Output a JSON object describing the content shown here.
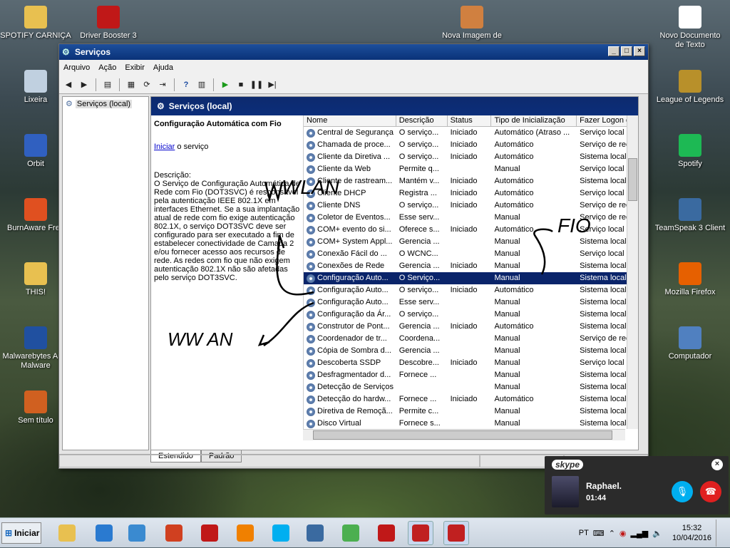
{
  "desktop_icons": [
    {
      "label": "SPOTIFY CARNIÇA",
      "icon": "folder-icon",
      "color": "#e8c050"
    },
    {
      "label": "Driver Booster 3",
      "icon": "driver-booster-icon",
      "color": "#c01818"
    },
    {
      "label": "Nova Imagem de",
      "icon": "image-file-icon",
      "color": "#d08040"
    },
    {
      "label": "Novo Documento de Texto",
      "icon": "text-document-icon",
      "color": "#ffffff"
    },
    {
      "label": "Lixeira",
      "icon": "recycle-bin-icon",
      "color": "#c0d0e0"
    },
    {
      "label": "League of Legends",
      "icon": "league-icon",
      "color": "#b8902a"
    },
    {
      "label": "Orbit",
      "icon": "orbit-icon",
      "color": "#3060c0"
    },
    {
      "label": "Spotify",
      "icon": "spotify-icon",
      "color": "#1db954"
    },
    {
      "label": "BurnAware Free",
      "icon": "burnaware-icon",
      "color": "#e05020"
    },
    {
      "label": "TeamSpeak 3 Client",
      "icon": "teamspeak-icon",
      "color": "#3a6aa0"
    },
    {
      "label": "THIS!",
      "icon": "folder-icon",
      "color": "#e8c050"
    },
    {
      "label": "Mozilla Firefox",
      "icon": "firefox-icon",
      "color": "#e66000"
    },
    {
      "label": "Malwarebytes Anti-Malware",
      "icon": "malwarebytes-icon",
      "color": "#2050a0"
    },
    {
      "label": "Computador",
      "icon": "computer-icon",
      "color": "#5080c0"
    },
    {
      "label": "Sem título",
      "icon": "paint-icon",
      "color": "#d06020"
    }
  ],
  "window": {
    "title": "Serviços",
    "menu": [
      "Arquivo",
      "Ação",
      "Exibir",
      "Ajuda"
    ],
    "tree_item": "Serviços (local)",
    "pane_header": "Serviços (local)",
    "selected_title": "Configuração Automática com Fio",
    "start_link": "Iniciar",
    "start_suffix": " o serviço",
    "desc_label": "Descrição:",
    "desc_text": "O Serviço de Configuração Automática de Rede com Fio (DOT3SVC) é responsável pela autenticação IEEE 802.1X em interfaces Ethernet. Se a sua implantação atual de rede com fio exige autenticação 802.1X, o serviço DOT3SVC deve ser configurado para ser executado a fim de estabelecer conectividade de Camada 2 e/ou fornecer acesso aos recursos de rede. As redes com fio que não exigem autenticação 802.1X não são afetadas pelo serviço DOT3SVC.",
    "columns": [
      "Nome",
      "Descrição",
      "Status",
      "Tipo de Inicialização",
      "Fazer Logon c"
    ],
    "rows": [
      [
        "Central de Segurança",
        "O serviço...",
        "Iniciado",
        "Automático (Atraso ...",
        "Serviço local"
      ],
      [
        "Chamada de proce...",
        "O serviço...",
        "Iniciado",
        "Automático",
        "Serviço de rec"
      ],
      [
        "Cliente da Diretiva ...",
        "O serviço...",
        "Iniciado",
        "Automático",
        "Sistema local"
      ],
      [
        "Cliente da Web",
        "Permite q...",
        "",
        "Manual",
        "Serviço local"
      ],
      [
        "Cliente de rastream...",
        "Mantém v...",
        "Iniciado",
        "Automático",
        "Sistema local"
      ],
      [
        "Cliente DHCP",
        "Registra ...",
        "Iniciado",
        "Automático",
        "Serviço local"
      ],
      [
        "Cliente DNS",
        "O serviço...",
        "Iniciado",
        "Automático",
        "Serviço de rec"
      ],
      [
        "Coletor de Eventos...",
        "Esse serv...",
        "",
        "Manual",
        "Serviço de rec"
      ],
      [
        "COM+ evento do si...",
        "Oferece s...",
        "Iniciado",
        "Automático",
        "Serviço local"
      ],
      [
        "COM+ System Appl...",
        "Gerencia ...",
        "",
        "Manual",
        "Sistema local"
      ],
      [
        "Conexão Fácil do ...",
        "O WCNC...",
        "",
        "Manual",
        "Serviço local"
      ],
      [
        "Conexões de Rede",
        "Gerencia ...",
        "Iniciado",
        "Manual",
        "Sistema local"
      ],
      [
        "Configuração Auto...",
        "O Serviço...",
        "",
        "Manual",
        "Sistema local"
      ],
      [
        "Configuração Auto...",
        "O serviço...",
        "Iniciado",
        "Automático",
        "Sistema local"
      ],
      [
        "Configuração Auto...",
        "Esse serv...",
        "",
        "Manual",
        "Sistema local"
      ],
      [
        "Configuração da Ár...",
        "O serviço...",
        "",
        "Manual",
        "Sistema local"
      ],
      [
        "Construtor de Pont...",
        "Gerencia ...",
        "Iniciado",
        "Automático",
        "Sistema local"
      ],
      [
        "Coordenador de tr...",
        "Coordena...",
        "",
        "Manual",
        "Serviço de rec"
      ],
      [
        "Cópia de Sombra d...",
        "Gerencia ...",
        "",
        "Manual",
        "Sistema local"
      ],
      [
        "Descoberta SSDP",
        "Descobre...",
        "Iniciado",
        "Manual",
        "Serviço local"
      ],
      [
        "Desfragmentador d...",
        "Fornece ...",
        "",
        "Manual",
        "Sistema local"
      ],
      [
        "Detecção de Serviços Interativos",
        "",
        "",
        "Manual",
        "Sistema local"
      ],
      [
        "Detecção do hardw...",
        "Fornece ...",
        "Iniciado",
        "Automático",
        "Sistema local"
      ],
      [
        "Diretiva de Remoçã...",
        "Permite c...",
        "",
        "Manual",
        "Sistema local"
      ],
      [
        "Disco Virtual",
        "Fornece s...",
        "",
        "Manual",
        "Sistema local"
      ]
    ],
    "selected_index": 12,
    "tabs": [
      "Estendido",
      "Padrão"
    ]
  },
  "annotations": {
    "wlan": "WLAN",
    "fio": "FIO",
    "wlan2": "WW AN"
  },
  "skype": {
    "logo": "skype",
    "name": "Raphael.",
    "duration": "01:44"
  },
  "taskbar": {
    "start": "Iniciar",
    "lang": "PT",
    "time": "15:32",
    "date": "10/04/2016",
    "apps": [
      {
        "name": "explorer-icon",
        "color": "#e8c050"
      },
      {
        "name": "ie-icon",
        "color": "#2a7ad0"
      },
      {
        "name": "media-icon",
        "color": "#3a8ad0"
      },
      {
        "name": "ccleaner-icon",
        "color": "#d04020"
      },
      {
        "name": "pdf-icon",
        "color": "#c01818"
      },
      {
        "name": "avast-icon",
        "color": "#f08000"
      },
      {
        "name": "skype-icon",
        "color": "#00aff0"
      },
      {
        "name": "control-panel-icon",
        "color": "#3a6aa0"
      },
      {
        "name": "chrome-icon",
        "color": "#4caf50"
      },
      {
        "name": "driver-booster-icon",
        "color": "#c01818"
      },
      {
        "name": "toolbox-icon",
        "color": "#c02020"
      },
      {
        "name": "toolbox-icon",
        "color": "#c02020"
      }
    ]
  }
}
